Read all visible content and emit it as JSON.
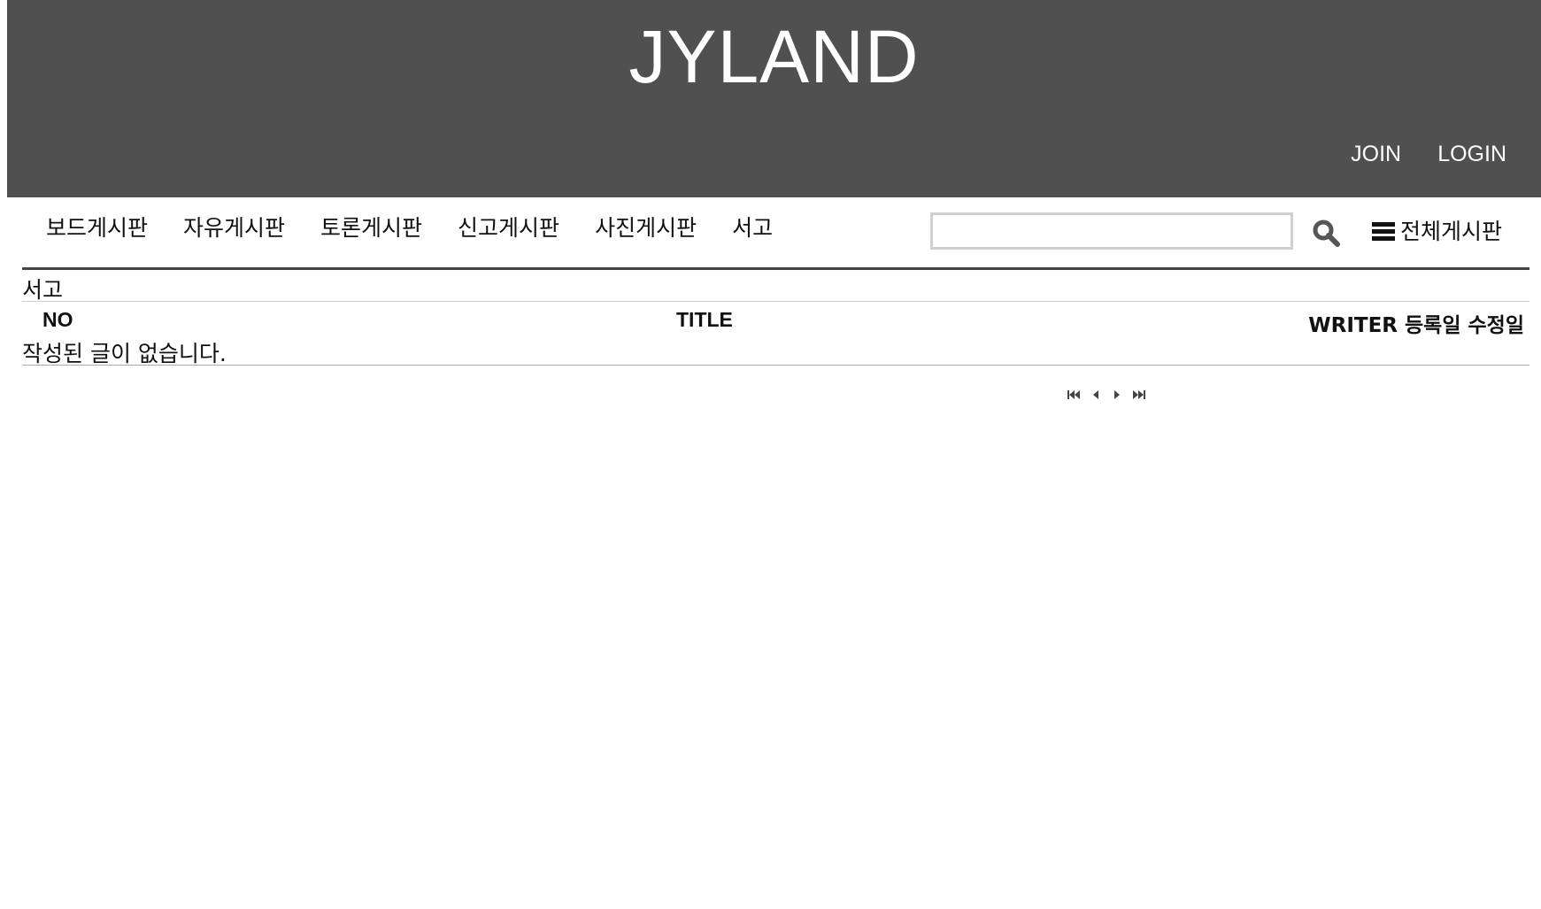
{
  "header": {
    "site_title": "JYLAND",
    "join_label": "JOIN",
    "login_label": "LOGIN",
    "background_color": "#505050"
  },
  "nav": {
    "items": [
      "보드게시판",
      "자유게시판",
      "토론게시판",
      "신고게시판",
      "사진게시판",
      "서고"
    ]
  },
  "search": {
    "value": "",
    "placeholder": "",
    "button_icon": "search-icon"
  },
  "all_boards": {
    "icon": "menu-icon",
    "label": "전체게시판"
  },
  "board": {
    "name": "서고",
    "columns": {
      "no": "NO",
      "title": "TITLE",
      "writer_dates": "WRITER 등록일 수정일"
    },
    "empty_message": "작성된 글이 없습니다."
  },
  "pagination": {
    "icons": [
      "first-page-icon",
      "prev-page-icon",
      "next-page-icon",
      "last-page-icon"
    ]
  }
}
